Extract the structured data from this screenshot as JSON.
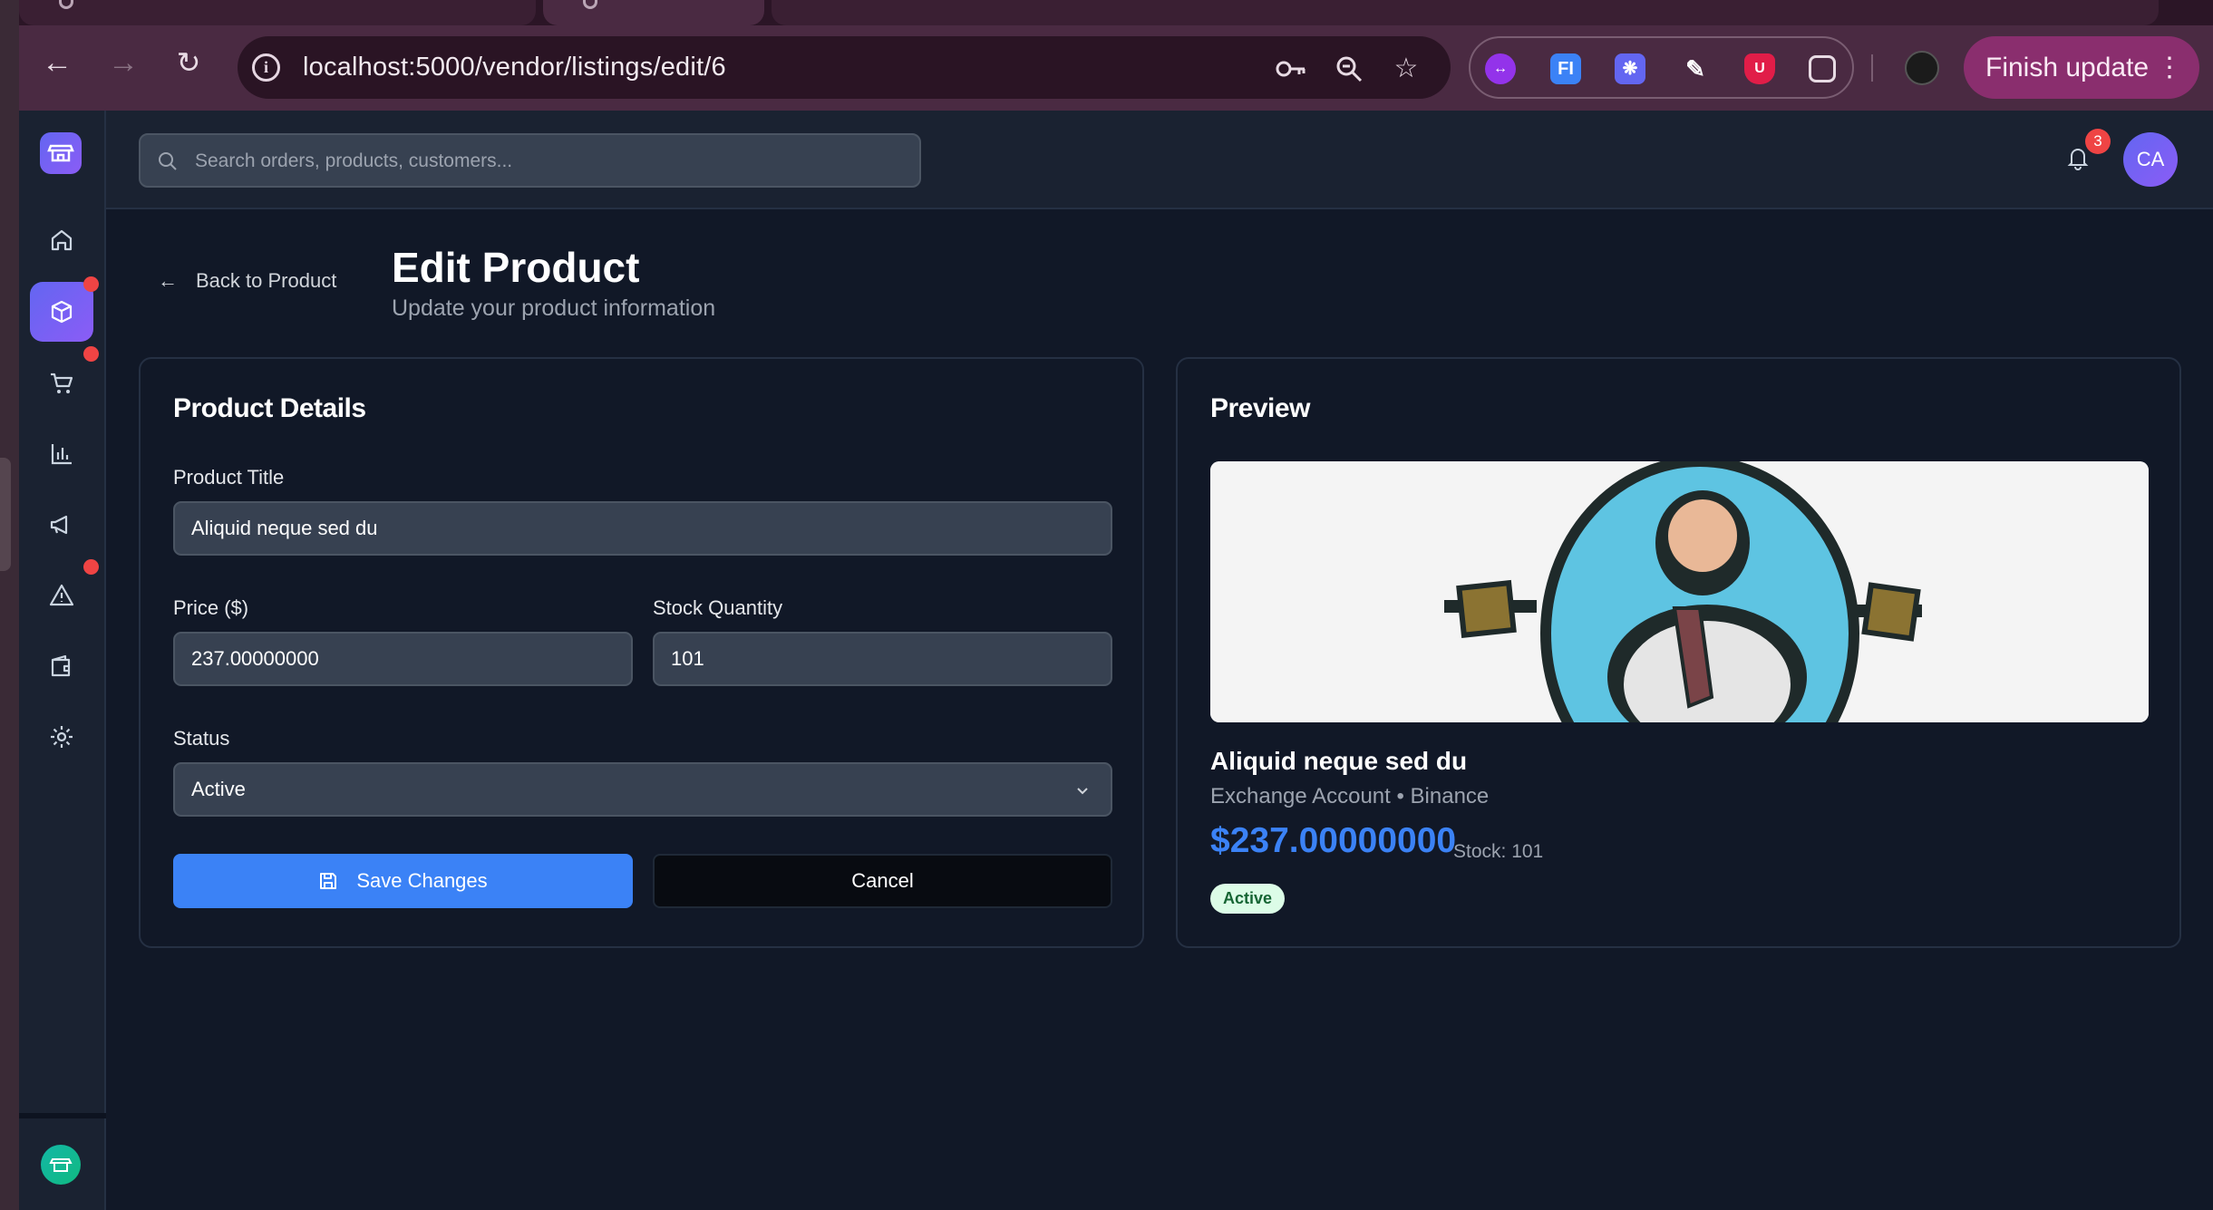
{
  "browser": {
    "url": "localhost:5000/vendor/listings/edit/6",
    "finish_update_label": "Finish update",
    "extensions": [
      "bracket-extension-icon",
      "fi-extension-icon",
      "snowflake-extension-icon",
      "eyedropper-extension-icon",
      "ublock-extension-icon",
      "puzzle-extension-icon"
    ]
  },
  "topbar": {
    "search_placeholder": "Search orders, products, customers...",
    "notification_count": "3",
    "avatar_initials": "CA"
  },
  "sidebar": {
    "items": [
      {
        "name": "home",
        "badge": false,
        "active": false
      },
      {
        "name": "products",
        "badge": true,
        "active": true
      },
      {
        "name": "orders",
        "badge": true,
        "active": false
      },
      {
        "name": "analytics",
        "badge": false,
        "active": false
      },
      {
        "name": "marketing",
        "badge": false,
        "active": false
      },
      {
        "name": "disputes",
        "badge": true,
        "active": false
      },
      {
        "name": "wallet",
        "badge": false,
        "active": false
      },
      {
        "name": "settings",
        "badge": false,
        "active": false
      }
    ]
  },
  "page": {
    "back_label": "Back to Product",
    "title": "Edit Product",
    "subtitle": "Update your product information"
  },
  "form": {
    "heading": "Product Details",
    "title_label": "Product Title",
    "title_value": "Aliquid neque sed du",
    "price_label": "Price ($)",
    "price_value": "237.00000000",
    "stock_label": "Stock Quantity",
    "stock_value": "101",
    "status_label": "Status",
    "status_value": "Active",
    "save_label": "Save Changes",
    "cancel_label": "Cancel"
  },
  "preview": {
    "heading": "Preview",
    "name": "Aliquid neque sed du",
    "category": "Exchange Account • Binance",
    "price": "$237.00000000",
    "stock": "Stock: 101",
    "status": "Active"
  },
  "colors": {
    "accent": "#3b82f6",
    "brand_gradient_start": "#6366f1",
    "brand_gradient_end": "#8b5cf6",
    "badge": "#ef4444",
    "status_active_bg": "#dcfce7"
  }
}
